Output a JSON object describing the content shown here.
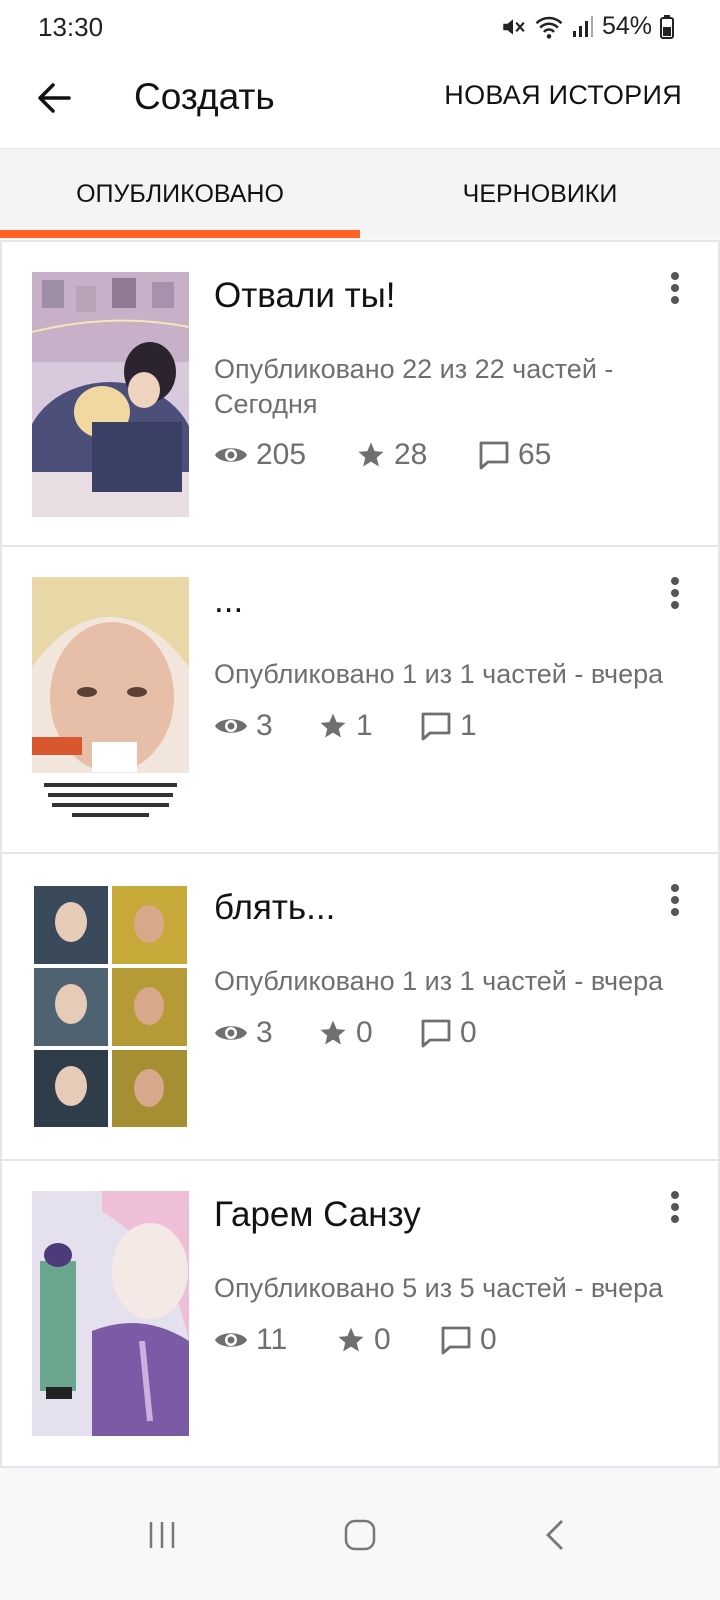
{
  "status_bar": {
    "time": "13:30",
    "battery": "54%",
    "icons": [
      "mute-icon",
      "wifi-icon",
      "signal-icon",
      "battery-icon"
    ]
  },
  "app_bar": {
    "title": "Создать",
    "new_story_label": "НОВАЯ ИСТОРИЯ",
    "back_icon": "arrow-left-icon"
  },
  "tabs": [
    {
      "label": "ОПУБЛИКОВАНО",
      "active": true
    },
    {
      "label": "ЧЕРНОВИКИ",
      "active": false
    }
  ],
  "accent_color": "#ff6122",
  "stories": [
    {
      "title": "Отвали ты!",
      "meta": "Опубликовано 22 из 22 частей - Сегодня",
      "views": "205",
      "votes": "28",
      "comments": "65"
    },
    {
      "title": "...",
      "meta": "Опубликовано 1 из 1 частей - вчера",
      "views": "3",
      "votes": "1",
      "comments": "1"
    },
    {
      "title": "блять...",
      "meta": "Опубликовано 1 из 1 частей - вчера",
      "views": "3",
      "votes": "0",
      "comments": "0"
    },
    {
      "title": "Гарем Санзу",
      "meta": "Опубликовано 5 из 5 частей - вчера",
      "views": "11",
      "votes": "0",
      "comments": "0"
    }
  ],
  "stat_icons": [
    "eye-icon",
    "star-icon",
    "comment-icon"
  ],
  "nav_bar": [
    "recents-icon",
    "home-icon",
    "back-nav-icon"
  ]
}
